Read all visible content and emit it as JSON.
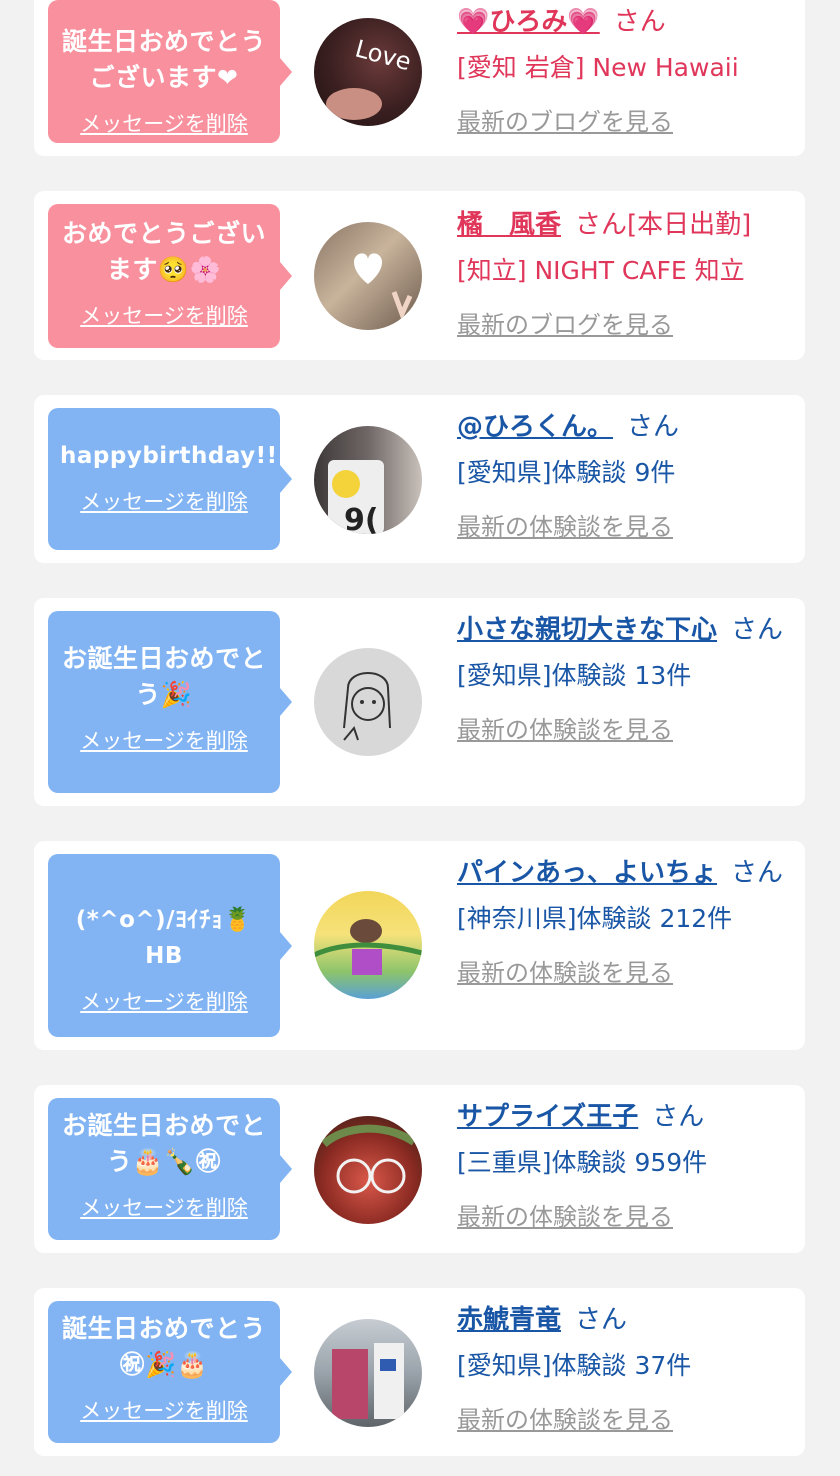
{
  "colors": {
    "pink_bubble": "#f8909d",
    "blue_bubble": "#82b4f4",
    "pink_text": "#e0365a",
    "blue_text": "#1a56a6",
    "link_gray": "#999999",
    "background": "#f2f2f2"
  },
  "cards": [
    {
      "bubble_color": "pink",
      "message": "誕生日おめでとうございます❤",
      "delete_label": "メッセージを削除",
      "name": "💗ひろみ💗",
      "suffix": "さん",
      "extra": "",
      "meta": "[愛知 岩倉] New Hawaii",
      "link_label": "最新のブログを見る",
      "avatar_icon": "photo-avatar"
    },
    {
      "bubble_color": "pink",
      "message": "おめでとうございます🥺🌸",
      "delete_label": "メッセージを削除",
      "name": "橘　風香",
      "suffix": "さん",
      "extra": "[本日出勤]",
      "meta": "[知立] NIGHT CAFE 知立",
      "link_label": "最新のブログを見る",
      "avatar_icon": "photo-avatar"
    },
    {
      "bubble_color": "blue",
      "message": "happybirthday!!",
      "delete_label": "メッセージを削除",
      "name": "@ひろくん。",
      "suffix": "さん",
      "extra": "",
      "meta": "[愛知県]体験談 9件",
      "link_label": "最新の体験談を見る",
      "avatar_icon": "photo-avatar"
    },
    {
      "bubble_color": "blue",
      "message": "お誕生日おめでとう🎉",
      "delete_label": "メッセージを削除",
      "name": "小さな親切大きな下心",
      "suffix": "さん",
      "extra": "",
      "meta": "[愛知県]体験談 13件",
      "link_label": "最新の体験談を見る",
      "avatar_icon": "sketch-avatar"
    },
    {
      "bubble_color": "blue",
      "message": "(*^o^)/ﾖｲﾁｮ🍍 HB",
      "delete_label": "メッセージを削除",
      "name": "パインあっ、よいちょ",
      "suffix": "さん",
      "extra": "",
      "meta": "[神奈川県]体験談 212件",
      "link_label": "最新の体験談を見る",
      "avatar_icon": "drawing-avatar"
    },
    {
      "bubble_color": "blue",
      "message": "お誕生日おめでとう🎂🍾㊗",
      "delete_label": "メッセージを削除",
      "name": "サプライズ王子",
      "suffix": "さん",
      "extra": "",
      "meta": "[三重県]体験談 959件",
      "link_label": "最新の体験談を見る",
      "avatar_icon": "photo-avatar"
    },
    {
      "bubble_color": "blue",
      "message": "誕生日おめでとう㊗🎉🎂",
      "delete_label": "メッセージを削除",
      "name": "赤鯱青竜",
      "suffix": "さん",
      "extra": "",
      "meta": "[愛知県]体験談 37件",
      "link_label": "最新の体験談を見る",
      "avatar_icon": "photo-avatar"
    }
  ]
}
